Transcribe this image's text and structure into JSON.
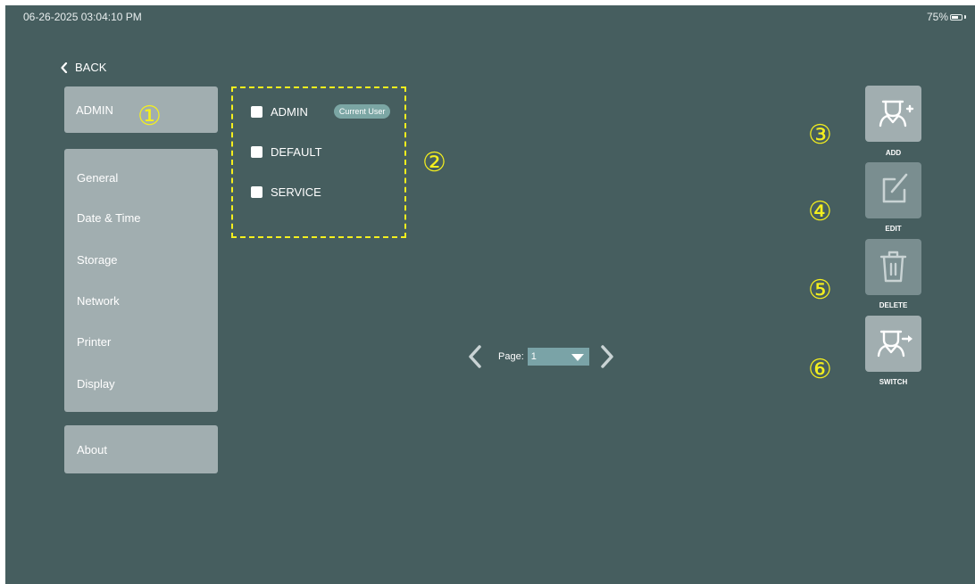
{
  "status_bar": {
    "datetime": "06-26-2025 03:04:10 PM",
    "battery_percent": "75%",
    "battery_level": 0.75
  },
  "nav": {
    "back_label": "BACK"
  },
  "current_user": {
    "label": "ADMIN"
  },
  "menu": {
    "items": [
      {
        "label": "General"
      },
      {
        "label": "Date & Time"
      },
      {
        "label": "Storage"
      },
      {
        "label": "Network"
      },
      {
        "label": "Printer"
      },
      {
        "label": "Display"
      }
    ],
    "about_label": "About"
  },
  "users": [
    {
      "name": "ADMIN",
      "badge": "Current User"
    },
    {
      "name": "DEFAULT"
    },
    {
      "name": "SERVICE"
    }
  ],
  "pagination": {
    "label": "Page:",
    "value": "1"
  },
  "actions": {
    "add_label": "ADD",
    "edit_label": "EDIT",
    "delete_label": "DELETE",
    "switch_label": "SWITCH"
  },
  "callouts": [
    "①",
    "②",
    "③",
    "④",
    "⑤",
    "⑥"
  ],
  "colors": {
    "background": "#465e5f",
    "panel": "#a1aeb0",
    "highlight": "#f4ef1e",
    "badge": "#7ba6a4"
  }
}
